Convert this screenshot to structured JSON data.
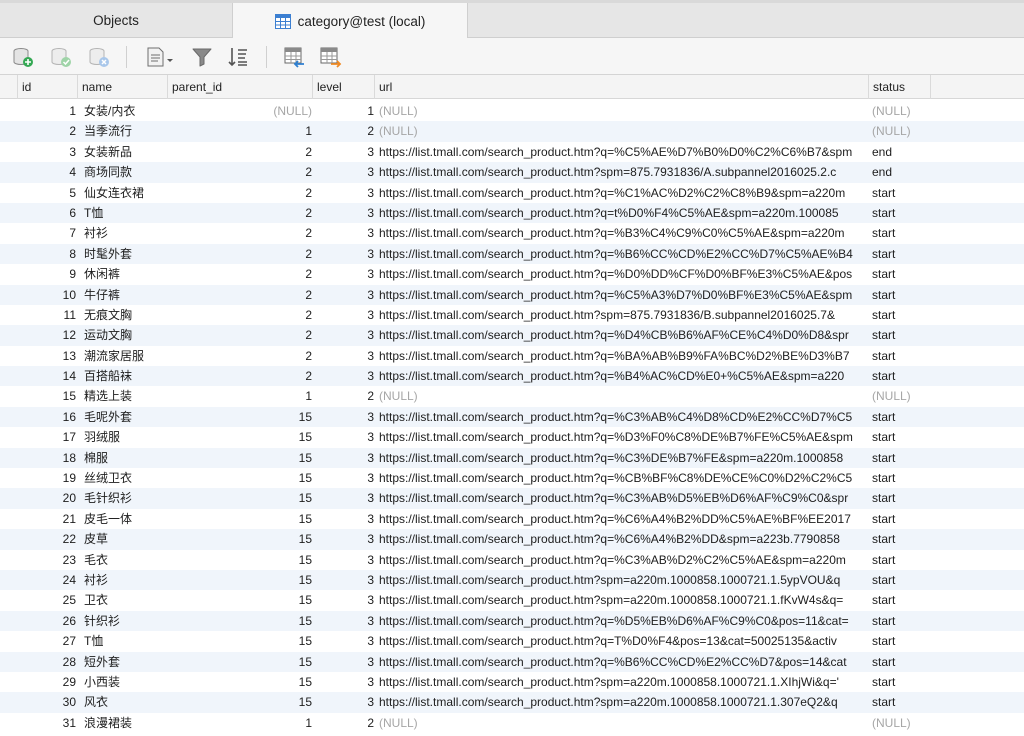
{
  "tabs": [
    {
      "label": "Objects",
      "active": false
    },
    {
      "label": "category@test (local)",
      "active": true
    }
  ],
  "toolbar": {
    "buttons": [
      "add-record-icon",
      "save-record-icon",
      "discard-record-icon",
      "text-format-icon",
      "filter-icon",
      "sort-icon",
      "import-icon",
      "export-icon"
    ]
  },
  "columns": [
    "id",
    "name",
    "parent_id",
    "level",
    "url",
    "status"
  ],
  "rows": [
    {
      "id": "1",
      "name": "女装/内衣",
      "parent_id": "(NULL)",
      "level": "1",
      "url": "(NULL)",
      "status": "(NULL)"
    },
    {
      "id": "2",
      "name": "当季流行",
      "parent_id": "1",
      "level": "2",
      "url": "(NULL)",
      "status": "(NULL)"
    },
    {
      "id": "3",
      "name": "女装新品",
      "parent_id": "2",
      "level": "3",
      "url": "https://list.tmall.com/search_product.htm?q=%C5%AE%D7%B0%D0%C2%C6%B7&spm",
      "status": "end"
    },
    {
      "id": "4",
      "name": "商场同款",
      "parent_id": "2",
      "level": "3",
      "url": "https://list.tmall.com/search_product.htm?spm=875.7931836/A.subpannel2016025.2.c",
      "status": "end"
    },
    {
      "id": "5",
      "name": "仙女连衣裙",
      "parent_id": "2",
      "level": "3",
      "url": "https://list.tmall.com/search_product.htm?q=%C1%AC%D2%C2%C8%B9&spm=a220m",
      "status": "start"
    },
    {
      "id": "6",
      "name": "T恤",
      "parent_id": "2",
      "level": "3",
      "url": "https://list.tmall.com/search_product.htm?q=t%D0%F4%C5%AE&spm=a220m.100085",
      "status": "start"
    },
    {
      "id": "7",
      "name": "衬衫",
      "parent_id": "2",
      "level": "3",
      "url": "https://list.tmall.com/search_product.htm?q=%B3%C4%C9%C0%C5%AE&spm=a220m",
      "status": "start"
    },
    {
      "id": "8",
      "name": "时髦外套",
      "parent_id": "2",
      "level": "3",
      "url": "https://list.tmall.com/search_product.htm?q=%B6%CC%CD%E2%CC%D7%C5%AE%B4",
      "status": "start"
    },
    {
      "id": "9",
      "name": "休闲裤",
      "parent_id": "2",
      "level": "3",
      "url": "https://list.tmall.com/search_product.htm?q=%D0%DD%CF%D0%BF%E3%C5%AE&pos",
      "status": "start"
    },
    {
      "id": "10",
      "name": "牛仔裤",
      "parent_id": "2",
      "level": "3",
      "url": "https://list.tmall.com/search_product.htm?q=%C5%A3%D7%D0%BF%E3%C5%AE&spm",
      "status": "start"
    },
    {
      "id": "11",
      "name": "无痕文胸",
      "parent_id": "2",
      "level": "3",
      "url": "https://list.tmall.com/search_product.htm?spm=875.7931836/B.subpannel2016025.7&",
      "status": "start"
    },
    {
      "id": "12",
      "name": "运动文胸",
      "parent_id": "2",
      "level": "3",
      "url": "https://list.tmall.com/search_product.htm?q=%D4%CB%B6%AF%CE%C4%D0%D8&spr",
      "status": "start"
    },
    {
      "id": "13",
      "name": "潮流家居服",
      "parent_id": "2",
      "level": "3",
      "url": "https://list.tmall.com/search_product.htm?q=%BA%AB%B9%FA%BC%D2%BE%D3%B7",
      "status": "start"
    },
    {
      "id": "14",
      "name": "百搭船袜",
      "parent_id": "2",
      "level": "3",
      "url": "https://list.tmall.com/search_product.htm?q=%B4%AC%CD%E0+%C5%AE&spm=a220",
      "status": "start"
    },
    {
      "id": "15",
      "name": "精选上装",
      "parent_id": "1",
      "level": "2",
      "url": "(NULL)",
      "status": "(NULL)"
    },
    {
      "id": "16",
      "name": "毛呢外套",
      "parent_id": "15",
      "level": "3",
      "url": "https://list.tmall.com/search_product.htm?q=%C3%AB%C4%D8%CD%E2%CC%D7%C5",
      "status": "start"
    },
    {
      "id": "17",
      "name": "羽绒服",
      "parent_id": "15",
      "level": "3",
      "url": "https://list.tmall.com/search_product.htm?q=%D3%F0%C8%DE%B7%FE%C5%AE&spm",
      "status": "start"
    },
    {
      "id": "18",
      "name": "棉服",
      "parent_id": "15",
      "level": "3",
      "url": "https://list.tmall.com/search_product.htm?q=%C3%DE%B7%FE&spm=a220m.1000858",
      "status": "start"
    },
    {
      "id": "19",
      "name": "丝绒卫衣",
      "parent_id": "15",
      "level": "3",
      "url": "https://list.tmall.com/search_product.htm?q=%CB%BF%C8%DE%CE%C0%D2%C2%C5",
      "status": "start"
    },
    {
      "id": "20",
      "name": "毛针织衫",
      "parent_id": "15",
      "level": "3",
      "url": "https://list.tmall.com/search_product.htm?q=%C3%AB%D5%EB%D6%AF%C9%C0&spr",
      "status": "start"
    },
    {
      "id": "21",
      "name": "皮毛一体",
      "parent_id": "15",
      "level": "3",
      "url": "https://list.tmall.com/search_product.htm?q=%C6%A4%B2%DD%C5%AE%BF%EE2017",
      "status": "start"
    },
    {
      "id": "22",
      "name": "皮草",
      "parent_id": "15",
      "level": "3",
      "url": "https://list.tmall.com/search_product.htm?q=%C6%A4%B2%DD&spm=a223b.7790858",
      "status": "start"
    },
    {
      "id": "23",
      "name": "毛衣",
      "parent_id": "15",
      "level": "3",
      "url": "https://list.tmall.com/search_product.htm?q=%C3%AB%D2%C2%C5%AE&spm=a220m",
      "status": "start"
    },
    {
      "id": "24",
      "name": "衬衫",
      "parent_id": "15",
      "level": "3",
      "url": "https://list.tmall.com/search_product.htm?spm=a220m.1000858.1000721.1.5ypVOU&q",
      "status": "start"
    },
    {
      "id": "25",
      "name": "卫衣",
      "parent_id": "15",
      "level": "3",
      "url": "https://list.tmall.com/search_product.htm?spm=a220m.1000858.1000721.1.fKvW4s&q=",
      "status": "start"
    },
    {
      "id": "26",
      "name": "针织衫",
      "parent_id": "15",
      "level": "3",
      "url": "https://list.tmall.com/search_product.htm?q=%D5%EB%D6%AF%C9%C0&pos=11&cat=",
      "status": "start"
    },
    {
      "id": "27",
      "name": "T恤",
      "parent_id": "15",
      "level": "3",
      "url": "https://list.tmall.com/search_product.htm?q=T%D0%F4&pos=13&cat=50025135&activ",
      "status": "start"
    },
    {
      "id": "28",
      "name": "短外套",
      "parent_id": "15",
      "level": "3",
      "url": "https://list.tmall.com/search_product.htm?q=%B6%CC%CD%E2%CC%D7&pos=14&cat",
      "status": "start"
    },
    {
      "id": "29",
      "name": "小西装",
      "parent_id": "15",
      "level": "3",
      "url": "https://list.tmall.com/search_product.htm?spm=a220m.1000858.1000721.1.XIhjWi&q='",
      "status": "start"
    },
    {
      "id": "30",
      "name": "风衣",
      "parent_id": "15",
      "level": "3",
      "url": "https://list.tmall.com/search_product.htm?spm=a220m.1000858.1000721.1.307eQ2&q",
      "status": "start"
    },
    {
      "id": "31",
      "name": "浪漫裙装",
      "parent_id": "1",
      "level": "2",
      "url": "(NULL)",
      "status": "(NULL)"
    }
  ]
}
